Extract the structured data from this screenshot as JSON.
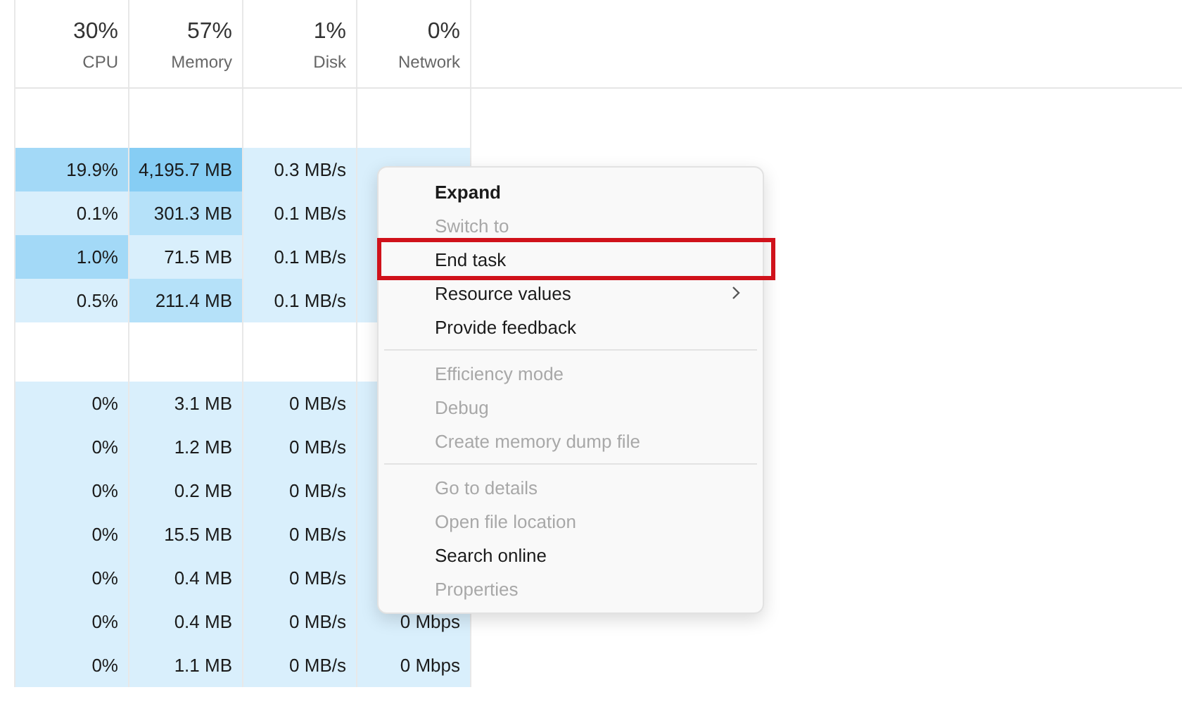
{
  "columns": [
    {
      "percent": "30%",
      "label": "CPU"
    },
    {
      "percent": "57%",
      "label": "Memory"
    },
    {
      "percent": "1%",
      "label": "Disk"
    },
    {
      "percent": "0%",
      "label": "Network"
    }
  ],
  "groups": [
    {
      "rows": [
        {
          "cells": [
            {
              "text": "19.9%",
              "color": "#a3d9f7"
            },
            {
              "text": "4,195.7 MB",
              "color": "#86cdf4"
            },
            {
              "text": "0.3 MB/s",
              "color": "#d9effc"
            },
            {
              "color": "#d9effc"
            }
          ]
        },
        {
          "cells": [
            {
              "text": "0.1%",
              "color": "#d9effc"
            },
            {
              "text": "301.3 MB",
              "color": "#b5e1f9"
            },
            {
              "text": "0.1 MB/s",
              "color": "#d9effc"
            },
            {
              "color": "#d9effc"
            }
          ]
        },
        {
          "cells": [
            {
              "text": "1.0%",
              "color": "#a3d9f7"
            },
            {
              "text": "71.5 MB",
              "color": "#d9effc"
            },
            {
              "text": "0.1 MB/s",
              "color": "#d9effc"
            },
            {
              "color": "#d9effc"
            }
          ]
        },
        {
          "cells": [
            {
              "text": "0.5%",
              "color": "#d9effc"
            },
            {
              "text": "211.4 MB",
              "color": "#b5e1f9"
            },
            {
              "text": "0.1 MB/s",
              "color": "#d9effc"
            },
            {
              "color": "#d9effc"
            }
          ]
        }
      ]
    },
    {
      "rows": [
        {
          "cells": [
            {
              "text": "0%",
              "color": "#d9effc"
            },
            {
              "text": "3.1 MB",
              "color": "#d9effc"
            },
            {
              "text": "0 MB/s",
              "color": "#d9effc"
            },
            {
              "color": "#d9effc"
            }
          ]
        },
        {
          "cells": [
            {
              "text": "0%",
              "color": "#d9effc"
            },
            {
              "text": "1.2 MB",
              "color": "#d9effc"
            },
            {
              "text": "0 MB/s",
              "color": "#d9effc"
            },
            {
              "color": "#d9effc"
            }
          ]
        },
        {
          "cells": [
            {
              "text": "0%",
              "color": "#d9effc"
            },
            {
              "text": "0.2 MB",
              "color": "#d9effc"
            },
            {
              "text": "0 MB/s",
              "color": "#d9effc"
            },
            {
              "color": "#d9effc"
            }
          ]
        },
        {
          "cells": [
            {
              "text": "0%",
              "color": "#d9effc"
            },
            {
              "text": "15.5 MB",
              "color": "#d9effc"
            },
            {
              "text": "0 MB/s",
              "color": "#d9effc"
            },
            {
              "color": "#d9effc"
            }
          ]
        },
        {
          "cells": [
            {
              "text": "0%",
              "color": "#d9effc"
            },
            {
              "text": "0.4 MB",
              "color": "#d9effc"
            },
            {
              "text": "0 MB/s",
              "color": "#d9effc"
            },
            {
              "color": "#d9effc"
            }
          ]
        },
        {
          "cells": [
            {
              "text": "0%",
              "color": "#d9effc"
            },
            {
              "text": "0.4 MB",
              "color": "#d9effc"
            },
            {
              "text": "0 MB/s",
              "color": "#d9effc"
            },
            {
              "text": "0 Mbps",
              "color": "#d9effc"
            }
          ]
        },
        {
          "cells": [
            {
              "text": "0%",
              "color": "#d9effc"
            },
            {
              "text": "1.1 MB",
              "color": "#d9effc"
            },
            {
              "text": "0 MB/s",
              "color": "#d9effc"
            },
            {
              "text": "0 Mbps",
              "color": "#d9effc"
            }
          ]
        }
      ]
    }
  ],
  "context_menu": {
    "items": [
      {
        "kind": "item",
        "label": "Expand",
        "default": true,
        "disabled": false,
        "highlighted": false
      },
      {
        "kind": "item",
        "label": "Switch to",
        "default": false,
        "disabled": true,
        "highlighted": false
      },
      {
        "kind": "item",
        "label": "End task",
        "default": false,
        "disabled": false,
        "highlighted": true
      },
      {
        "kind": "item",
        "label": "Resource values",
        "default": false,
        "disabled": false,
        "highlighted": false,
        "submenu": true
      },
      {
        "kind": "item",
        "label": "Provide feedback",
        "default": false,
        "disabled": false,
        "highlighted": false
      },
      {
        "kind": "separator"
      },
      {
        "kind": "item",
        "label": "Efficiency mode",
        "default": false,
        "disabled": true,
        "highlighted": false
      },
      {
        "kind": "item",
        "label": "Debug",
        "default": false,
        "disabled": true,
        "highlighted": false
      },
      {
        "kind": "item",
        "label": "Create memory dump file",
        "default": false,
        "disabled": true,
        "highlighted": false
      },
      {
        "kind": "separator"
      },
      {
        "kind": "item",
        "label": "Go to details",
        "default": false,
        "disabled": true,
        "highlighted": false
      },
      {
        "kind": "item",
        "label": "Open file location",
        "default": false,
        "disabled": true,
        "highlighted": false
      },
      {
        "kind": "item",
        "label": "Search online",
        "default": false,
        "disabled": false,
        "highlighted": false
      },
      {
        "kind": "item",
        "label": "Properties",
        "default": false,
        "disabled": true,
        "highlighted": false
      }
    ]
  }
}
